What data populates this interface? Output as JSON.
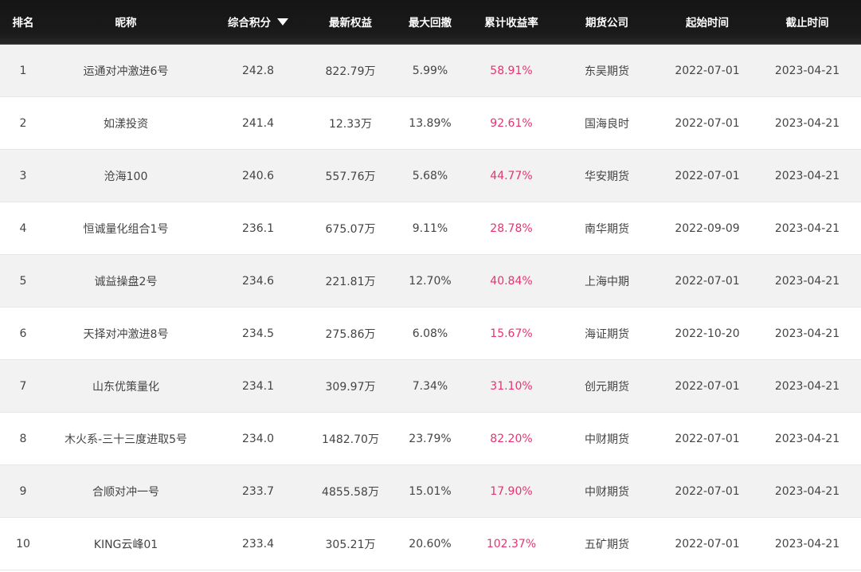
{
  "header": {
    "rank": "排名",
    "nickname": "昵称",
    "score": "综合积分",
    "equity": "最新权益",
    "drawdown": "最大回撤",
    "return": "累计收益率",
    "broker": "期货公司",
    "start": "起始时间",
    "end": "截止时间"
  },
  "rows": [
    {
      "rank": "1",
      "nickname": "运通对冲激进6号",
      "score": "242.8",
      "equity": "822.79万",
      "drawdown": "5.99%",
      "return": "58.91%",
      "broker": "东吴期货",
      "start": "2022-07-01",
      "end": "2023-04-21"
    },
    {
      "rank": "2",
      "nickname": "如漾投资",
      "score": "241.4",
      "equity": "12.33万",
      "drawdown": "13.89%",
      "return": "92.61%",
      "broker": "国海良时",
      "start": "2022-07-01",
      "end": "2023-04-21"
    },
    {
      "rank": "3",
      "nickname": "沧海100",
      "score": "240.6",
      "equity": "557.76万",
      "drawdown": "5.68%",
      "return": "44.77%",
      "broker": "华安期货",
      "start": "2022-07-01",
      "end": "2023-04-21"
    },
    {
      "rank": "4",
      "nickname": "恒诚量化组合1号",
      "score": "236.1",
      "equity": "675.07万",
      "drawdown": "9.11%",
      "return": "28.78%",
      "broker": "南华期货",
      "start": "2022-09-09",
      "end": "2023-04-21"
    },
    {
      "rank": "5",
      "nickname": "诚益操盘2号",
      "score": "234.6",
      "equity": "221.81万",
      "drawdown": "12.70%",
      "return": "40.84%",
      "broker": "上海中期",
      "start": "2022-07-01",
      "end": "2023-04-21"
    },
    {
      "rank": "6",
      "nickname": "天择对冲激进8号",
      "score": "234.5",
      "equity": "275.86万",
      "drawdown": "6.08%",
      "return": "15.67%",
      "broker": "海证期货",
      "start": "2022-10-20",
      "end": "2023-04-21"
    },
    {
      "rank": "7",
      "nickname": "山东优策量化",
      "score": "234.1",
      "equity": "309.97万",
      "drawdown": "7.34%",
      "return": "31.10%",
      "broker": "创元期货",
      "start": "2022-07-01",
      "end": "2023-04-21"
    },
    {
      "rank": "8",
      "nickname": "木火系-三十三度进取5号",
      "score": "234.0",
      "equity": "1482.70万",
      "drawdown": "23.79%",
      "return": "82.20%",
      "broker": "中财期货",
      "start": "2022-07-01",
      "end": "2023-04-21"
    },
    {
      "rank": "9",
      "nickname": "合顺对冲一号",
      "score": "233.7",
      "equity": "4855.58万",
      "drawdown": "15.01%",
      "return": "17.90%",
      "broker": "中财期货",
      "start": "2022-07-01",
      "end": "2023-04-21"
    },
    {
      "rank": "10",
      "nickname": "KING云峰01",
      "score": "233.4",
      "equity": "305.21万",
      "drawdown": "20.60%",
      "return": "102.37%",
      "broker": "五矿期货",
      "start": "2022-07-01",
      "end": "2023-04-21"
    }
  ],
  "colors": {
    "header_bg": "#151515",
    "row_odd": "#f2f2f2",
    "row_even": "#ffffff",
    "return_text": "#e8336d"
  },
  "icons": {
    "sort": "triangle-down-icon"
  }
}
